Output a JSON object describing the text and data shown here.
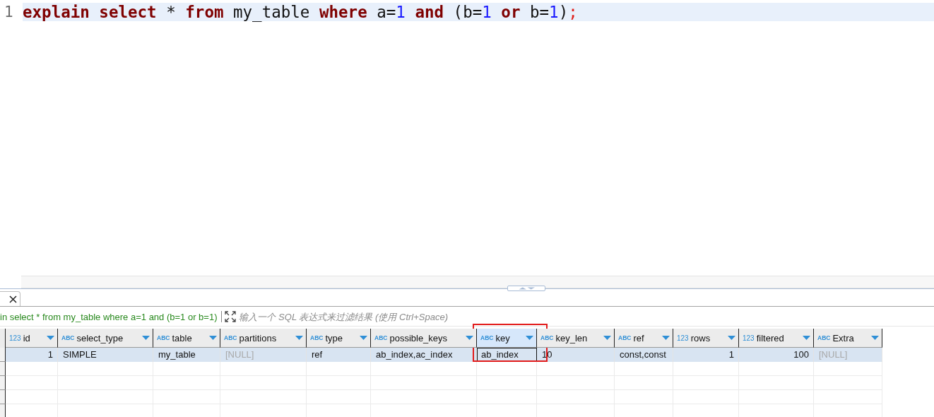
{
  "editor": {
    "lines": [
      {
        "number": "1",
        "current": true,
        "tokens": [
          {
            "text": "explain select",
            "kind": "keyword"
          },
          {
            "text": " * ",
            "kind": "plain"
          },
          {
            "text": "from",
            "kind": "keyword"
          },
          {
            "text": " my_table ",
            "kind": "plain"
          },
          {
            "text": "where",
            "kind": "keyword"
          },
          {
            "text": " a=",
            "kind": "plain"
          },
          {
            "text": "1",
            "kind": "number"
          },
          {
            "text": " and",
            "kind": "keyword"
          },
          {
            "text": " (b=",
            "kind": "plain"
          },
          {
            "text": "1",
            "kind": "number"
          },
          {
            "text": " or",
            "kind": "keyword"
          },
          {
            "text": " b=",
            "kind": "plain"
          },
          {
            "text": "1",
            "kind": "number"
          },
          {
            "text": ")",
            "kind": "plain"
          },
          {
            "text": ";",
            "kind": "punct"
          }
        ]
      }
    ]
  },
  "results": {
    "tab": {
      "closable": true
    },
    "filter": {
      "query": "in select * from my_table where a=1 and (b=1 or b=1)",
      "placeholder": "输入一个 SQL 表达式来过滤结果 (使用 Ctrl+Space)"
    },
    "columns": [
      {
        "type_label": "123",
        "kind": "number",
        "name": "id",
        "selected": false,
        "highlighted": false
      },
      {
        "type_label": "ABC",
        "kind": "text",
        "name": "select_type",
        "selected": false,
        "highlighted": false
      },
      {
        "type_label": "ABC",
        "kind": "text",
        "name": "table",
        "selected": false,
        "highlighted": false
      },
      {
        "type_label": "ABC",
        "kind": "text",
        "name": "partitions",
        "selected": false,
        "highlighted": false
      },
      {
        "type_label": "ABC",
        "kind": "text",
        "name": "type",
        "selected": false,
        "highlighted": false
      },
      {
        "type_label": "ABC",
        "kind": "text",
        "name": "possible_keys",
        "selected": false,
        "highlighted": false
      },
      {
        "type_label": "ABC",
        "kind": "text",
        "name": "key",
        "selected": true,
        "highlighted": true
      },
      {
        "type_label": "ABC",
        "kind": "text",
        "name": "key_len",
        "selected": false,
        "highlighted": false
      },
      {
        "type_label": "ABC",
        "kind": "text",
        "name": "ref",
        "selected": false,
        "highlighted": false
      },
      {
        "type_label": "123",
        "kind": "number",
        "name": "rows",
        "selected": false,
        "highlighted": false
      },
      {
        "type_label": "123",
        "kind": "number",
        "name": "filtered",
        "selected": false,
        "highlighted": false
      },
      {
        "type_label": "ABC",
        "kind": "text",
        "name": "Extra",
        "selected": false,
        "highlighted": false
      }
    ],
    "rows": [
      {
        "selected": true,
        "cells": [
          {
            "text": "1",
            "null": false,
            "focused": false
          },
          {
            "text": "SIMPLE",
            "null": false,
            "focused": false
          },
          {
            "text": "my_table",
            "null": false,
            "focused": false
          },
          {
            "text": "[NULL]",
            "null": true,
            "focused": false
          },
          {
            "text": "ref",
            "null": false,
            "focused": false
          },
          {
            "text": "ab_index,ac_index",
            "null": false,
            "focused": false
          },
          {
            "text": "ab_index",
            "null": false,
            "focused": true
          },
          {
            "text": "10",
            "null": false,
            "focused": false
          },
          {
            "text": "const,const",
            "null": false,
            "focused": false
          },
          {
            "text": "1",
            "null": false,
            "focused": false
          },
          {
            "text": "100",
            "null": false,
            "focused": false
          },
          {
            "text": "[NULL]",
            "null": true,
            "focused": false
          }
        ]
      }
    ]
  }
}
